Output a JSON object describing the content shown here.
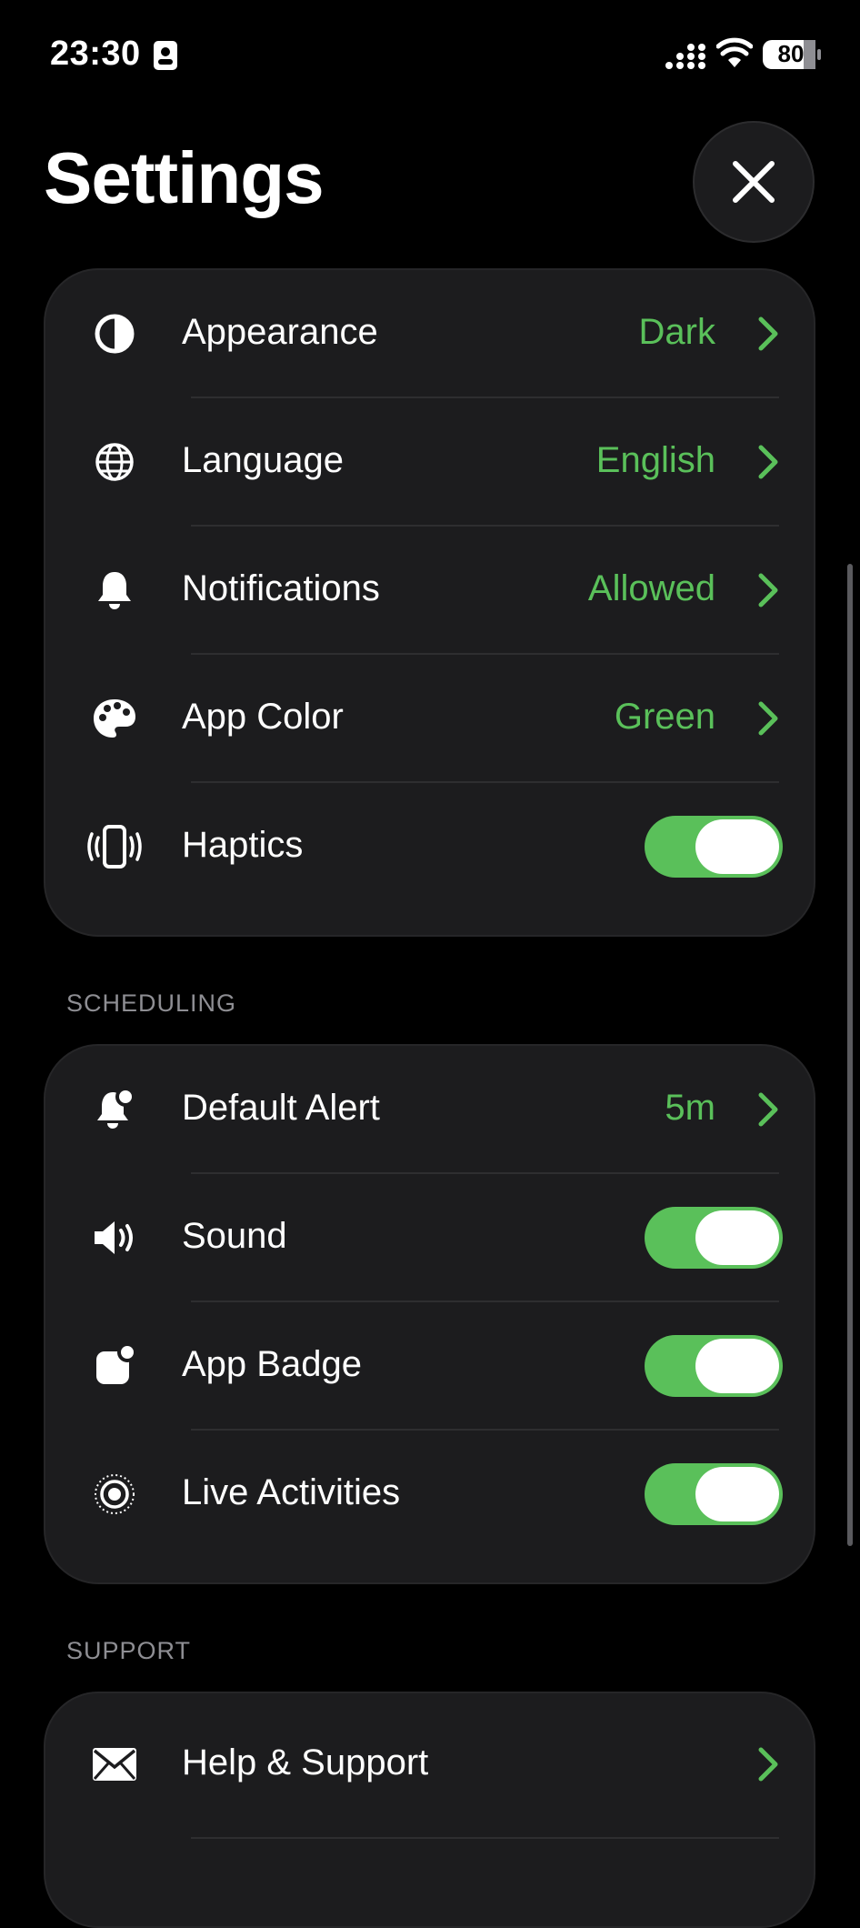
{
  "status_bar": {
    "time": "23:30",
    "battery": "80"
  },
  "header": {
    "title": "Settings"
  },
  "general": [
    {
      "label": "Appearance",
      "value": "Dark",
      "icon": "contrast-icon"
    },
    {
      "label": "Language",
      "value": "English",
      "icon": "globe-icon"
    },
    {
      "label": "Notifications",
      "value": "Allowed",
      "icon": "bell-icon"
    },
    {
      "label": "App Color",
      "value": "Green",
      "icon": "palette-icon"
    },
    {
      "label": "Haptics",
      "toggle": true,
      "icon": "haptics-icon"
    }
  ],
  "scheduling": {
    "header": "SCHEDULING",
    "items": [
      {
        "label": "Default Alert",
        "value": "5m",
        "icon": "bell-badge-icon"
      },
      {
        "label": "Sound",
        "toggle": true,
        "icon": "speaker-icon"
      },
      {
        "label": "App Badge",
        "toggle": true,
        "icon": "app-badge-icon"
      },
      {
        "label": "Live Activities",
        "toggle": true,
        "icon": "live-activity-icon"
      }
    ]
  },
  "support": {
    "header": "SUPPORT",
    "items": [
      {
        "label": "Help & Support",
        "icon": "envelope-icon"
      }
    ]
  },
  "colors": {
    "accent": "#5ac05a",
    "card": "#1c1c1e",
    "background": "#000000"
  }
}
